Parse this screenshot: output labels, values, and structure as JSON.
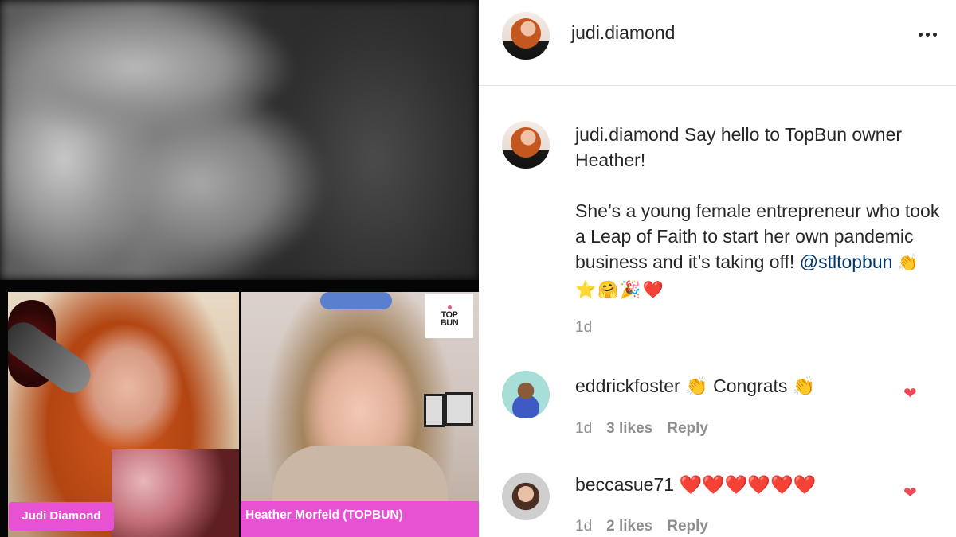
{
  "video": {
    "participants": [
      {
        "name": "Judi Diamond"
      },
      {
        "name": "Heather Morfeld (TOPBUN)"
      }
    ],
    "logo_top": "TOP",
    "logo_bottom": "BUN"
  },
  "post": {
    "author": "judi.diamond",
    "caption_author": "judi.diamond",
    "caption_line1": "Say hello to TopBun owner Heather!",
    "caption_para2": "She’s a young female entrepreneur who took a Leap of Faith to start her own pandemic business and it’s taking off!",
    "mention": "@stltopbun",
    "caption_emojis": "👏⭐🤗🎉❤️",
    "time": "1d"
  },
  "comments": [
    {
      "user": "eddrickfoster",
      "text": "👏 Congrats 👏",
      "time": "1d",
      "likes": "3 likes",
      "reply": "Reply",
      "liked": true
    },
    {
      "user": "beccasue71",
      "text": "❤️❤️❤️❤️❤️❤️",
      "time": "1d",
      "likes": "2 likes",
      "reply": "Reply",
      "liked": true
    }
  ],
  "colors": {
    "nametag": "#e652d1",
    "heart": "#ed4956",
    "mention": "#00376b"
  }
}
